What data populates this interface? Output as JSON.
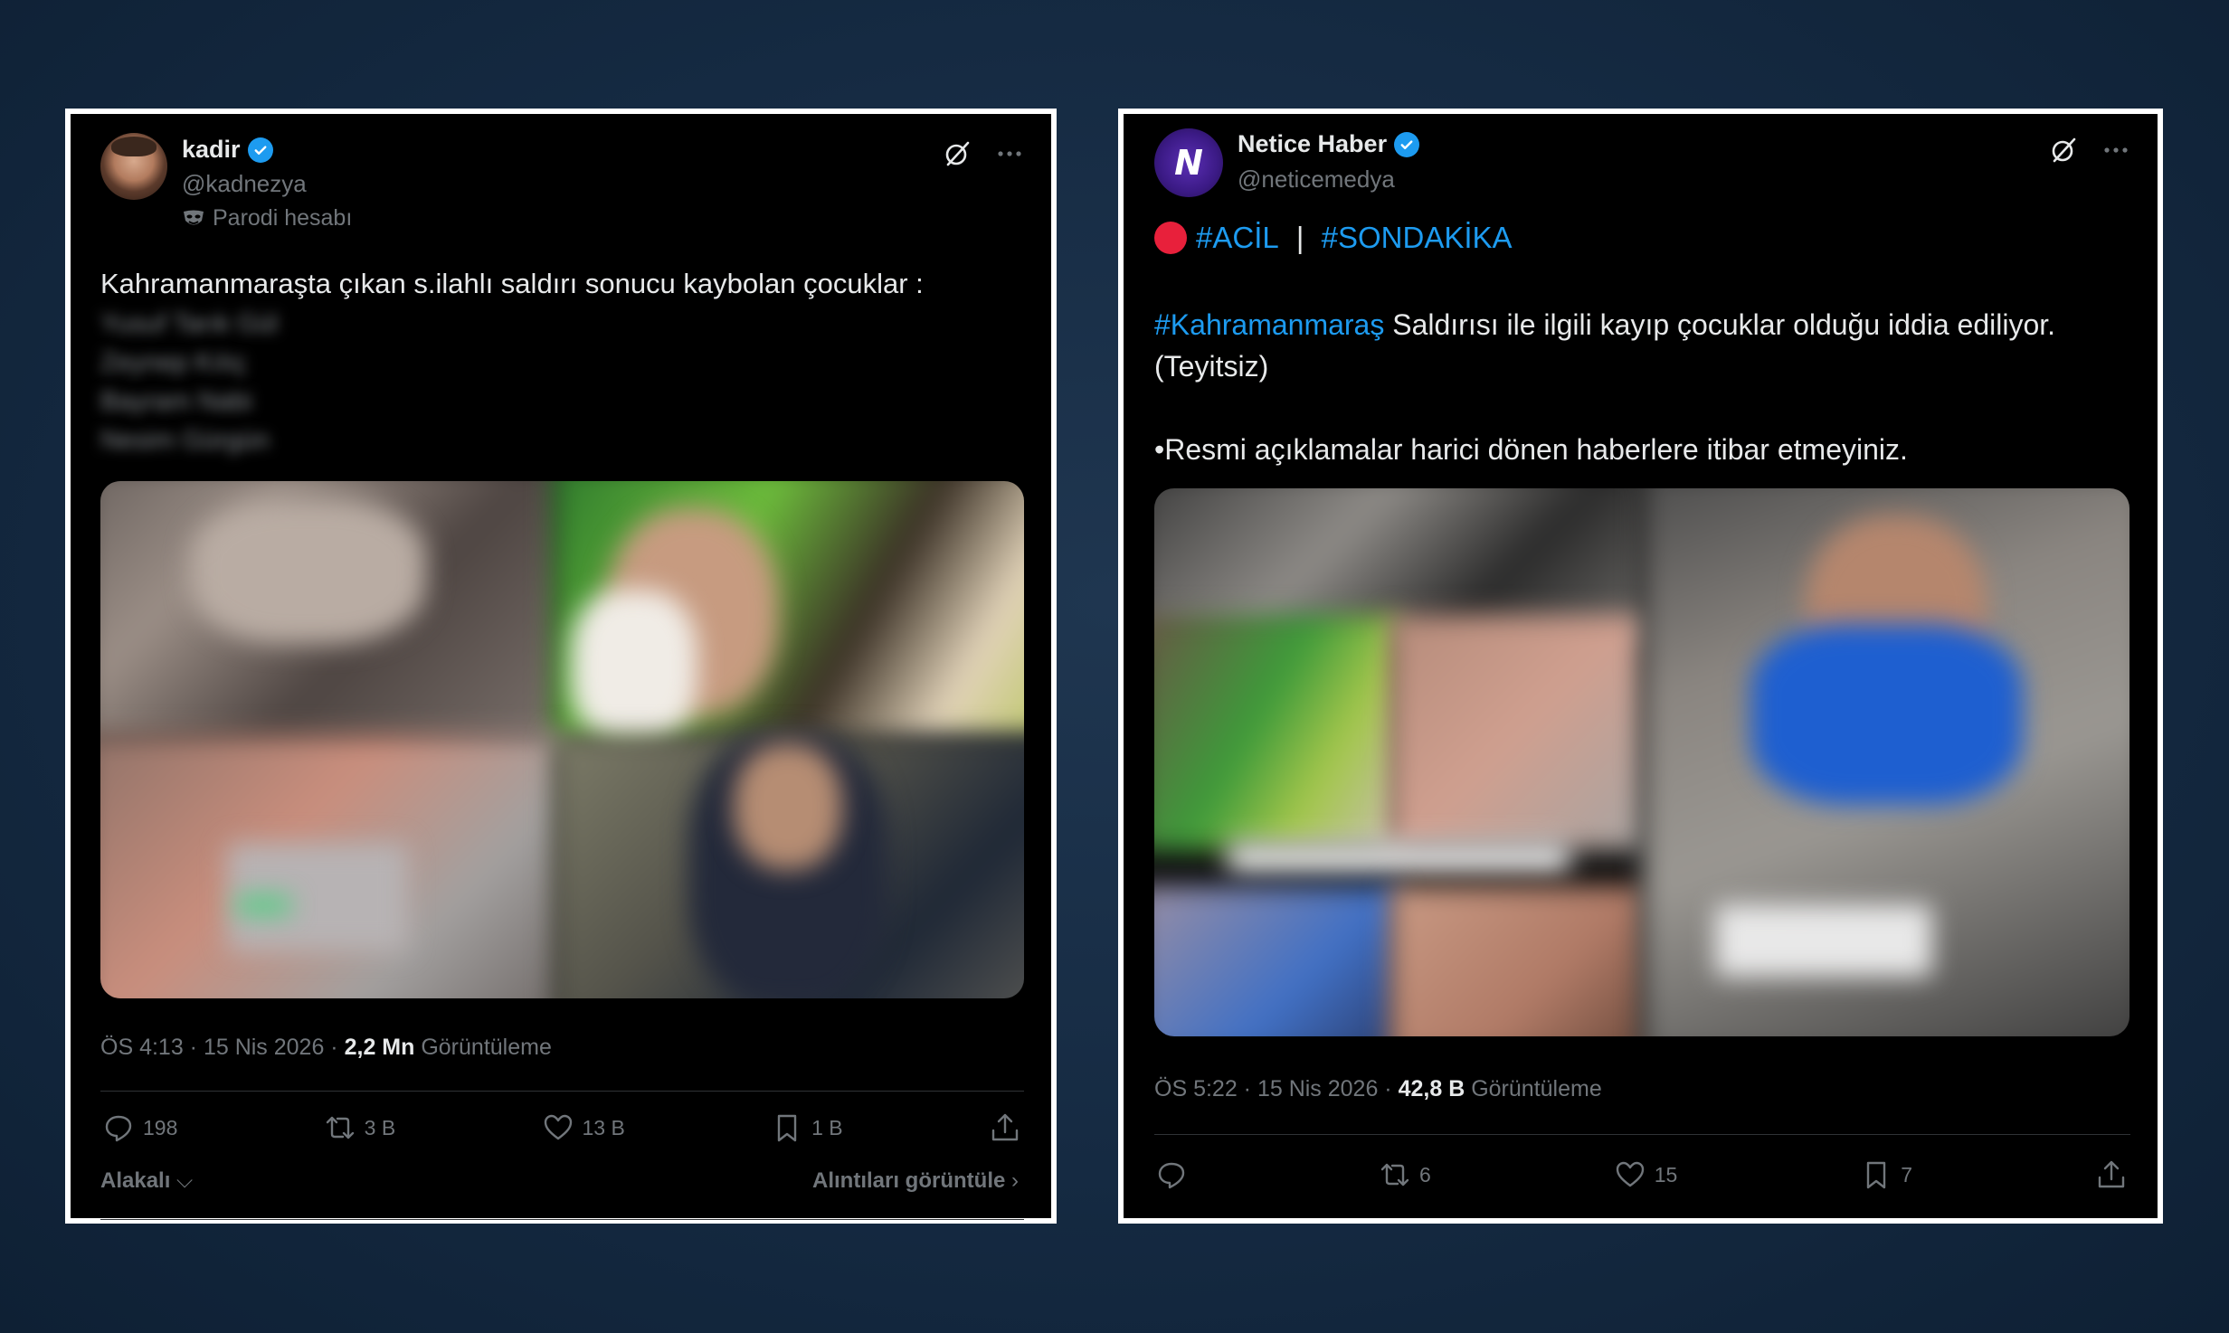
{
  "posts": [
    {
      "name": "kadir",
      "handle": "@kadnezya",
      "label": "Parodi hesabı",
      "text": "Kahramanmaraşta çıkan s.ilahlı saldırı sonucu kaybolan çocuklar :",
      "redacted_names": [
        "Yusuf Tarık Gül",
        "Zeynep Kılıç",
        "Bayram Nabi",
        "Nesim Gürgün"
      ],
      "time": "ÖS 4:13 · 15 Nis 2026 · ",
      "views_count": "2,2 Mn",
      "views_label": " Görüntüleme",
      "replies": "198",
      "reposts": "3 B",
      "likes": "13 B",
      "bookmarks": "1 B",
      "footer_left": "Alakalı",
      "footer_right": "Alıntıları görüntüle"
    },
    {
      "name": "Netice Haber",
      "handle": "@neticemedya",
      "hashtag1": "#ACİL",
      "separator": " | ",
      "hashtag2": "#SONDAKİKA",
      "hashtag3": "#Kahramanmaraş",
      "text_rest": " Saldırısı ile ilgili kayıp çocuklar olduğu iddia ediliyor.\n(Teyitsiz)",
      "text2": "•Resmi açıklamalar harici dönen haberlere itibar etmeyiniz.",
      "time": "ÖS 5:22 · 15 Nis 2026 · ",
      "views_count": "42,8 B",
      "views_label": " Görüntüleme",
      "replies": "",
      "reposts": "6",
      "likes": "15",
      "bookmarks": "7"
    }
  ],
  "colors": {
    "accent": "#1d9bf0",
    "text": "#e7e9ea",
    "muted": "#71767b",
    "card_bg": "#000000",
    "page_bg": "#152a42"
  }
}
